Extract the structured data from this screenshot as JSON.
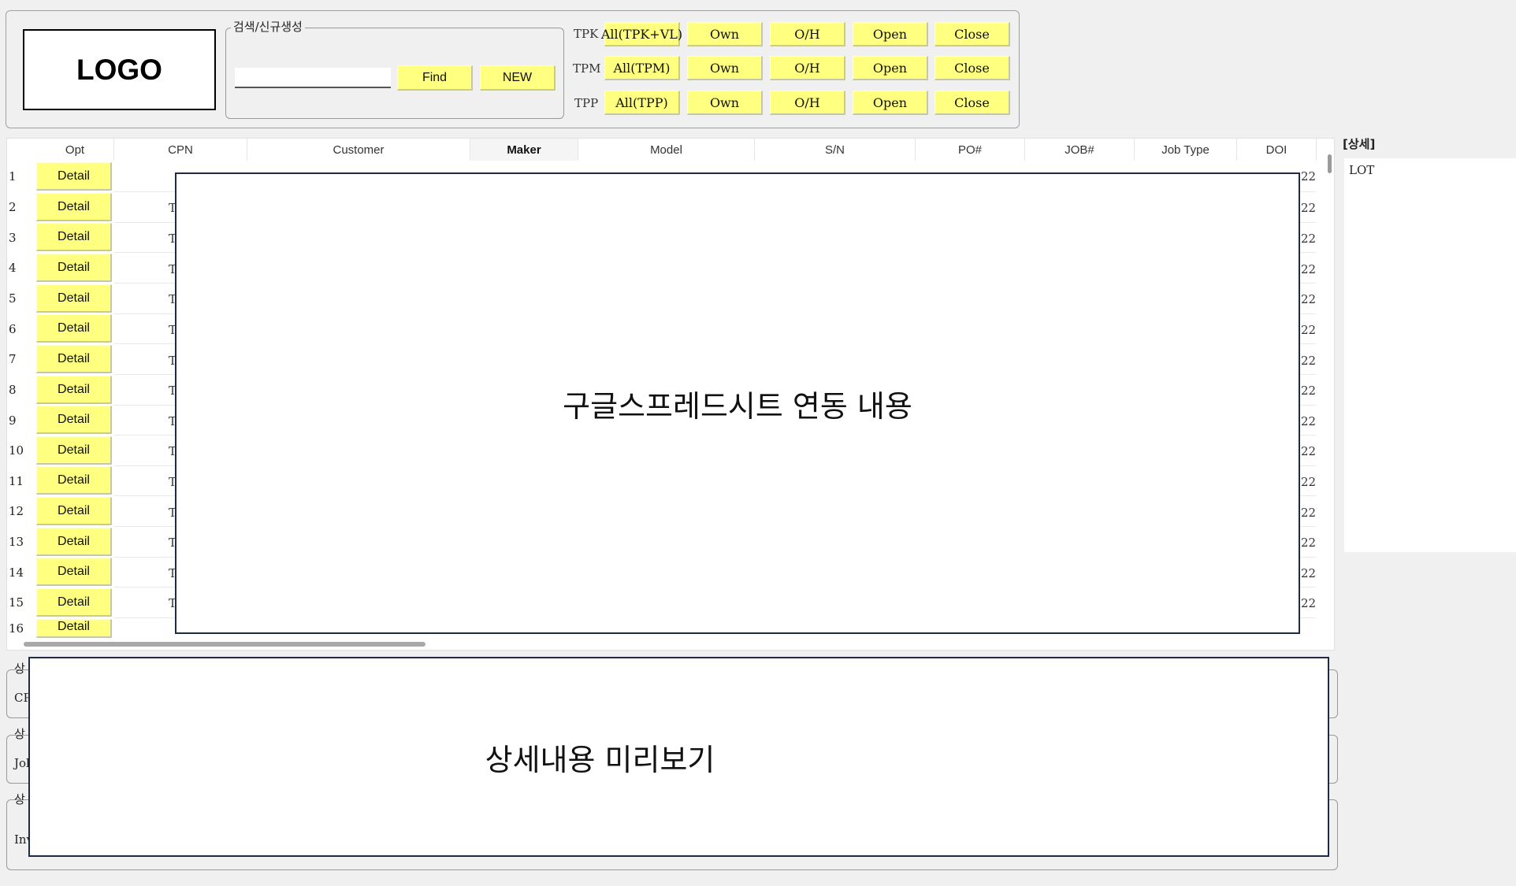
{
  "logo": {
    "text": "LOGO"
  },
  "search": {
    "group_label": "검색/신규생성",
    "value": "",
    "placeholder": "",
    "find_label": "Find",
    "new_label": "NEW"
  },
  "filters": [
    {
      "label": "TPK",
      "all": "All(TPK+VL)",
      "own": "Own",
      "oh": "O/H",
      "open": "Open",
      "close": "Close"
    },
    {
      "label": "TPM",
      "all": "All(TPM)",
      "own": "Own",
      "oh": "O/H",
      "open": "Open",
      "close": "Close"
    },
    {
      "label": "TPP",
      "all": "All(TPP)",
      "own": "Own",
      "oh": "O/H",
      "open": "Open",
      "close": "Close"
    }
  ],
  "grid": {
    "columns": [
      "Opt",
      "CPN",
      "Customer",
      "Maker",
      "Model",
      "S/N",
      "PO#",
      "JOB#",
      "Job Type",
      "DOI"
    ],
    "detail_label": "Detail",
    "rows": [
      "1",
      "2",
      "3",
      "4",
      "5",
      "6",
      "7",
      "8",
      "9",
      "10",
      "11",
      "12",
      "13",
      "14",
      "15",
      "16"
    ],
    "cpn_peek": "T",
    "doi_peek": "22",
    "overlay_text": "구글스프레드시트 연동 내용"
  },
  "detail": {
    "title": "[상세]",
    "first_item": "LOT"
  },
  "lower": {
    "group_label_peek": "상",
    "row1_peek": "CP",
    "row2_peek": "Job",
    "row3_peek": "Inv",
    "preview_text": "상세내용 미리보기"
  },
  "colors": {
    "button": "#ffff80",
    "overlay_border": "#1f2a44"
  }
}
